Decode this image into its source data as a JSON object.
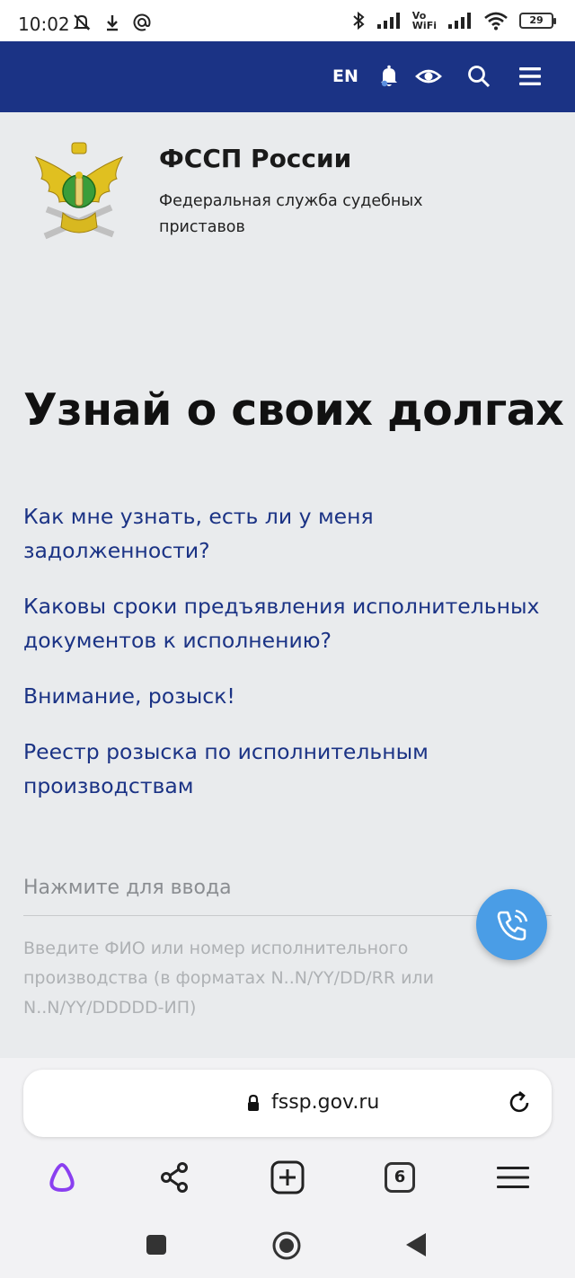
{
  "status_bar": {
    "time": "10:02",
    "vowifi_line1": "Vo",
    "vowifi_line2": "WiFi",
    "battery": "29"
  },
  "header": {
    "lang": "EN",
    "icons": [
      "bell-icon",
      "eye-icon",
      "search-icon",
      "menu-icon"
    ],
    "background": "#1b3385"
  },
  "brand": {
    "title": "ФССП России",
    "subtitle": "Федеральная служба судебных приставов"
  },
  "headline": "Узнай о своих долгах",
  "links": [
    "Как мне узнать, есть ли у меня задолженности?",
    "Каковы сроки предъявления исполнительных документов к исполнению?",
    "Внимание, розыск!",
    "Реестр розыска по исполнительным производствам"
  ],
  "search": {
    "placeholder": "Нажмите для ввода",
    "hint": "Введите ФИО или номер исполнительного производства (в форматах N..N/YY/DD/RR или N..N/YY/DDDDD-ИП)"
  },
  "browser": {
    "url": "fssp.gov.ru",
    "tab_count": "6",
    "accent": "#8a3ff0"
  }
}
